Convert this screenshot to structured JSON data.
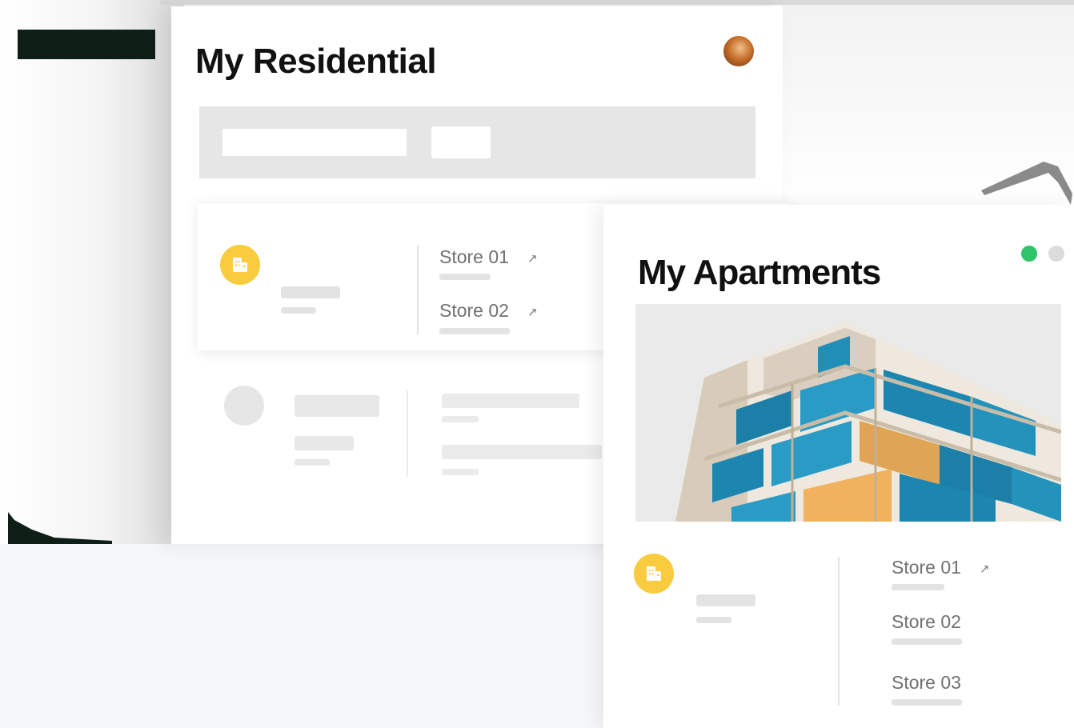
{
  "residential": {
    "title": "My Residential",
    "property_row": {
      "stores": [
        {
          "label": "Store 01",
          "link_icon": "↗"
        },
        {
          "label": "Store 02",
          "link_icon": "↗"
        }
      ]
    }
  },
  "apartments": {
    "title": "My Apartments",
    "indicator_colors": {
      "active": "#2ec56a",
      "inactive": "#dcdcdc"
    },
    "property_row": {
      "stores": [
        {
          "label": "Store 01",
          "link_icon": "↗"
        },
        {
          "label": "Store 02"
        },
        {
          "label": "Store 03"
        }
      ]
    }
  },
  "colors": {
    "badge": "#f8cc3e",
    "title_text": "#111111",
    "store_text": "#707070",
    "skeleton": "#e3e3e3"
  },
  "icons": {
    "badge": "building-icon",
    "store_link": "external-link-icon",
    "user": "user-avatar"
  }
}
